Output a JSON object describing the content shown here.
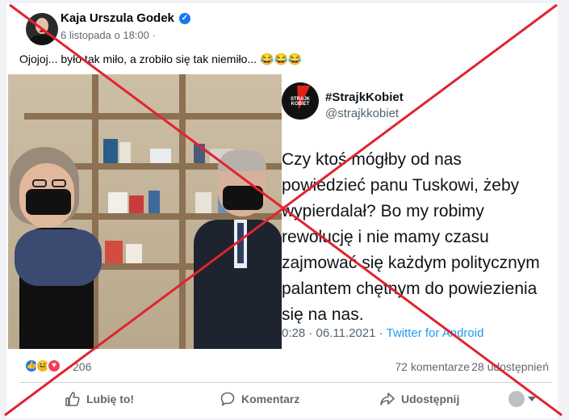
{
  "post": {
    "author": "Kaja Urszula Godek",
    "date": "6 listopada o 18:00 ·",
    "text": "Ojojoj... było tak miło, a zrobiło się tak niemiło... 😂😂😂"
  },
  "tweet": {
    "logo_text": "STRAJK KOBIET",
    "name": "#StrajkKobiet",
    "handle": "@strajkkobiet",
    "body": "Czy ktoś mógłby od nas powiedzieć panu Tuskowi, żeby wypierdalał? Bo my robimy rewolucję i nie mamy czasu zajmować się każdym politycznym palantem chętnym do powiezienia się na nas.",
    "time": "0:28 · 06.11.2021 · ",
    "source": "Twitter for Android"
  },
  "stats": {
    "reactions_count": "206",
    "comments": "72 komentarze",
    "shares": "28 udostępnień"
  },
  "actions": {
    "like": "Lubię to!",
    "comment": "Komentarz",
    "share": "Udostępnij"
  },
  "icons": {
    "verified": "verified-badge-icon",
    "reactions": [
      "like-reaction-icon",
      "haha-reaction-icon",
      "love-reaction-icon"
    ],
    "like": "thumbs-up-icon",
    "comment": "speech-bubble-icon",
    "share": "share-arrow-icon"
  },
  "colors": {
    "cross": "#e0242e",
    "facebook_blue": "#1877f2",
    "twitter_blue": "#1d9bf0"
  }
}
